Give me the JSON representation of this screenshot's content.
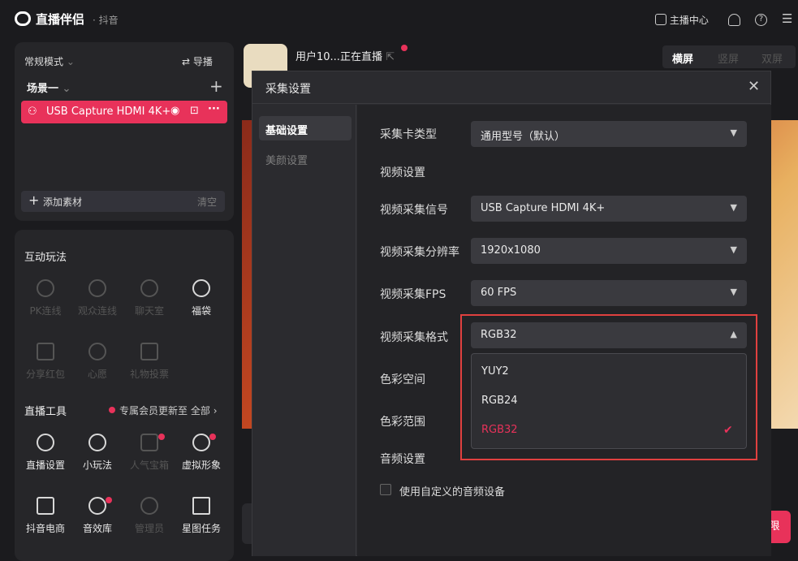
{
  "app": {
    "title": "直播伴侣",
    "subtitle": "· 抖音"
  },
  "topbar": {
    "host_center": "主播中心"
  },
  "left": {
    "mode": "常规模式",
    "guide": "导播",
    "scene": "场景一",
    "source_item": "USB Capture HDMI 4K+",
    "add_material": "添加素材",
    "clear": "清空"
  },
  "interactive": {
    "title": "互动玩法",
    "items": [
      "PK连线",
      "观众连线",
      "聊天室",
      "福袋",
      "分享红包",
      "心愿",
      "礼物投票"
    ]
  },
  "tools": {
    "title": "直播工具",
    "notice": "专属会员更新至",
    "all": "全部",
    "items": [
      "直播设置",
      "小玩法",
      "人气宝箱",
      "虚拟形象",
      "抖音电商",
      "音效库",
      "管理员",
      "星图任务"
    ]
  },
  "stream": {
    "user": "用户10...正在直播",
    "orientations": [
      "横屏",
      "竖屏",
      "双屏"
    ],
    "start_label": "限"
  },
  "modal": {
    "title": "采集设置",
    "nav": [
      "基础设置",
      "美颜设置"
    ],
    "card_type_label": "采集卡类型",
    "card_type_value": "通用型号（默认）",
    "video_section": "视频设置",
    "signal_label": "视频采集信号",
    "signal_value": "USB Capture HDMI 4K+",
    "resolution_label": "视频采集分辨率",
    "resolution_value": "1920x1080",
    "fps_label": "视频采集FPS",
    "fps_value": "60 FPS",
    "format_label": "视频采集格式",
    "format_value": "RGB32",
    "color_space_label": "色彩空间",
    "color_range_label": "色彩范围",
    "format_options": [
      "YUY2",
      "RGB24",
      "RGB32"
    ],
    "audio_section": "音频设置",
    "custom_audio": "使用自定义的音频设备"
  },
  "colors": {
    "accent": "#e8325a",
    "highlight": "#e0403f"
  }
}
